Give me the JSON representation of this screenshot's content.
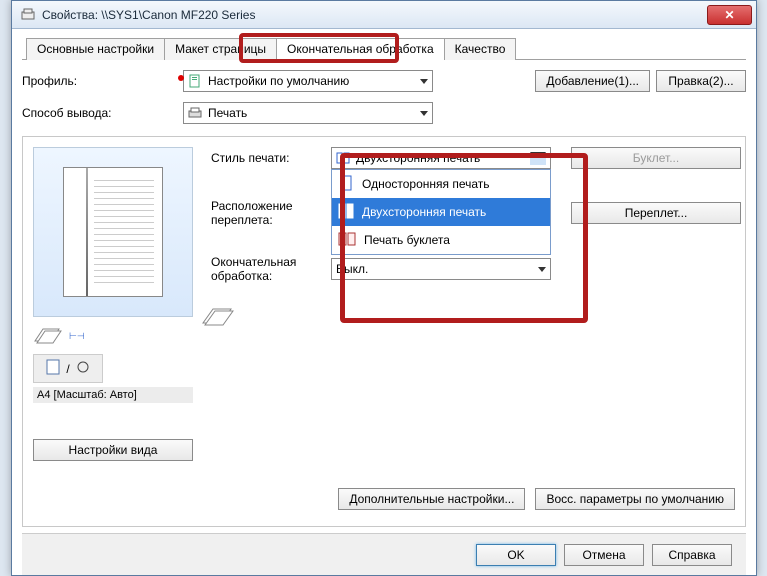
{
  "window": {
    "title": "Свойства: \\\\SYS1\\Canon MF220 Series"
  },
  "tabs": [
    "Основные настройки",
    "Макет страницы",
    "Окончательная обработка",
    "Качество"
  ],
  "profile": {
    "label": "Профиль:",
    "value": "Настройки по умолчанию",
    "add_btn": "Добавление(1)...",
    "edit_btn": "Правка(2)..."
  },
  "output": {
    "label": "Способ вывода:",
    "value": "Печать"
  },
  "preview": {
    "status": "A4 [Масштаб: Авто]",
    "view_btn": "Настройки вида"
  },
  "style": {
    "label": "Стиль печати:",
    "value": "Двухсторонняя печать",
    "options": [
      "Односторонняя печать",
      "Двухсторонняя печать",
      "Печать буклета"
    ],
    "booklet_btn": "Буклет..."
  },
  "binding": {
    "label": "Расположение переплета:",
    "gutter_btn": "Переплет..."
  },
  "finishing": {
    "label": "Окончательная обработка:",
    "value": "Выкл."
  },
  "footer": {
    "advanced": "Дополнительные настройки...",
    "restore": "Восс. параметры по умолчанию"
  },
  "bottom": {
    "ok": "OK",
    "cancel": "Отмена",
    "help": "Справка"
  }
}
